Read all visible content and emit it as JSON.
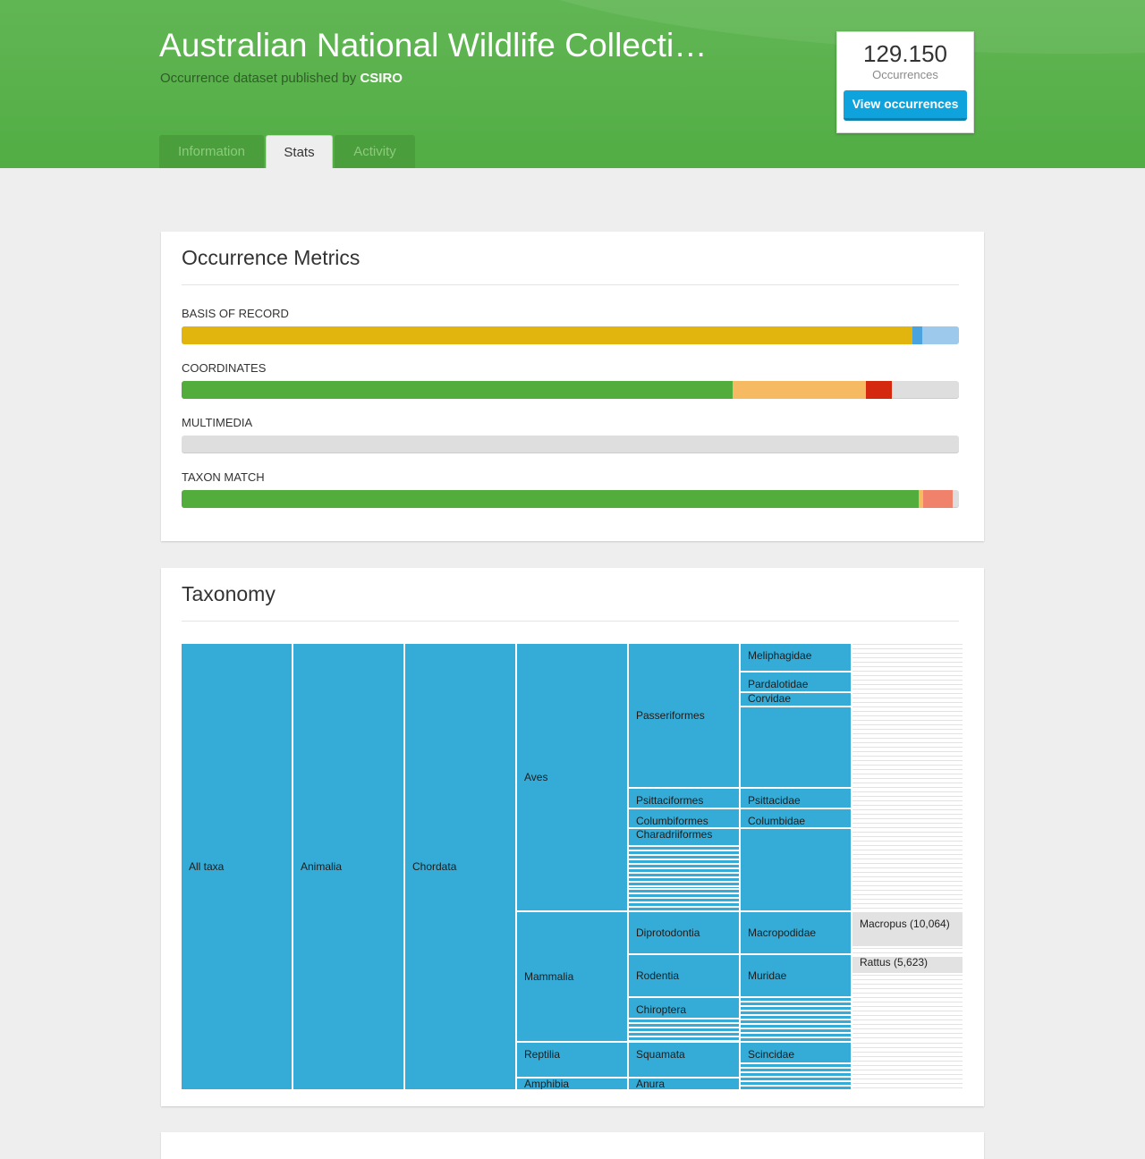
{
  "header": {
    "title": "Australian National Wildlife Collecti…",
    "subtitle_prefix": "Occurrence dataset published by",
    "publisher": "CSIRO",
    "count": "129.150",
    "count_label": "Occurrences",
    "view_button": "View occurrences"
  },
  "tabs": [
    {
      "label": "Information",
      "active": false
    },
    {
      "label": "Stats",
      "active": true
    },
    {
      "label": "Activity",
      "active": false
    }
  ],
  "metrics": {
    "title": "Occurrence Metrics",
    "colors": {
      "yellow": "#e2b50e",
      "blue": "#4aa3df",
      "light_blue": "#9cc9ec",
      "green": "#52ad3c",
      "orange": "#f6ba63",
      "red": "#d4290e",
      "salmon": "#f0826c",
      "grey": "#dedede"
    },
    "items": [
      {
        "label": "BASIS OF RECORD",
        "segments": [
          {
            "fraction": 0.94,
            "color": "#e2b50e"
          },
          {
            "fraction": 0.013,
            "color": "#4aa3df"
          },
          {
            "fraction": 0.047,
            "color": "#9cc9ec"
          }
        ]
      },
      {
        "label": "COORDINATES",
        "segments": [
          {
            "fraction": 0.709,
            "color": "#52ad3c"
          },
          {
            "fraction": 0.171,
            "color": "#f6ba63"
          },
          {
            "fraction": 0.034,
            "color": "#d4290e"
          }
        ]
      },
      {
        "label": "MULTIMEDIA",
        "segments": []
      },
      {
        "label": "TAXON MATCH",
        "segments": [
          {
            "fraction": 0.948,
            "color": "#52ad3c"
          },
          {
            "fraction": 0.006,
            "color": "#f6ba63"
          },
          {
            "fraction": 0.038,
            "color": "#f0826c"
          }
        ]
      }
    ]
  },
  "taxonomy": {
    "title": "Taxonomy",
    "colors": {
      "node": "#35acd7",
      "leaf": "#e2e2e2",
      "gap": "#ffffff"
    },
    "total": 500,
    "columns": [
      [
        {
          "name": "All taxa",
          "size": 500
        }
      ],
      [
        {
          "name": "Animalia",
          "size": 500
        }
      ],
      [
        {
          "name": "Chordata",
          "size": 500
        }
      ],
      [
        {
          "name": "Aves",
          "size": 300
        },
        {
          "name": "Mammalia",
          "size": 146
        },
        {
          "name": "Reptilia",
          "size": 40
        },
        {
          "name": "Amphibia",
          "size": 14
        }
      ],
      [
        {
          "name": "Passeriformes",
          "size": 162
        },
        {
          "name": "Psittaciformes",
          "size": 23
        },
        {
          "name": "Columbiformes",
          "size": 22
        },
        {
          "name": "Charadriiformes",
          "size": 20
        },
        {
          "name": "",
          "size": 48
        },
        {
          "name": "",
          "size": 25
        },
        {
          "name": "Diprotodontia",
          "size": 48
        },
        {
          "name": "Rodentia",
          "size": 48
        },
        {
          "name": "Chiroptera",
          "size": 24
        },
        {
          "name": "",
          "size": 26
        },
        {
          "name": "Squamata",
          "size": 40
        },
        {
          "name": "Anura",
          "size": 14
        }
      ],
      [
        {
          "name": "Meliphagidae",
          "size": 32
        },
        {
          "name": "Pardalotidae",
          "size": 23
        },
        {
          "name": "Corvidae",
          "size": 16
        },
        {
          "name": "",
          "size": 91
        },
        {
          "name": "Psittacidae",
          "size": 23
        },
        {
          "name": "Columbidae",
          "size": 22
        },
        {
          "name": "",
          "size": 93
        },
        {
          "name": "Macropodidae",
          "size": 48
        },
        {
          "name": "Muridae",
          "size": 48
        },
        {
          "name": "",
          "size": 50
        },
        {
          "name": "Scincidae",
          "size": 24
        },
        {
          "name": "",
          "size": 30
        }
      ],
      [
        {
          "name": "",
          "size": 300
        },
        {
          "name": "Macropus (10,064)",
          "size": 40
        },
        {
          "name": "",
          "size": 10
        },
        {
          "name": "Rattus (5,623)",
          "size": 20
        },
        {
          "name": "",
          "size": 76
        },
        {
          "name": "",
          "size": 54
        }
      ]
    ]
  }
}
